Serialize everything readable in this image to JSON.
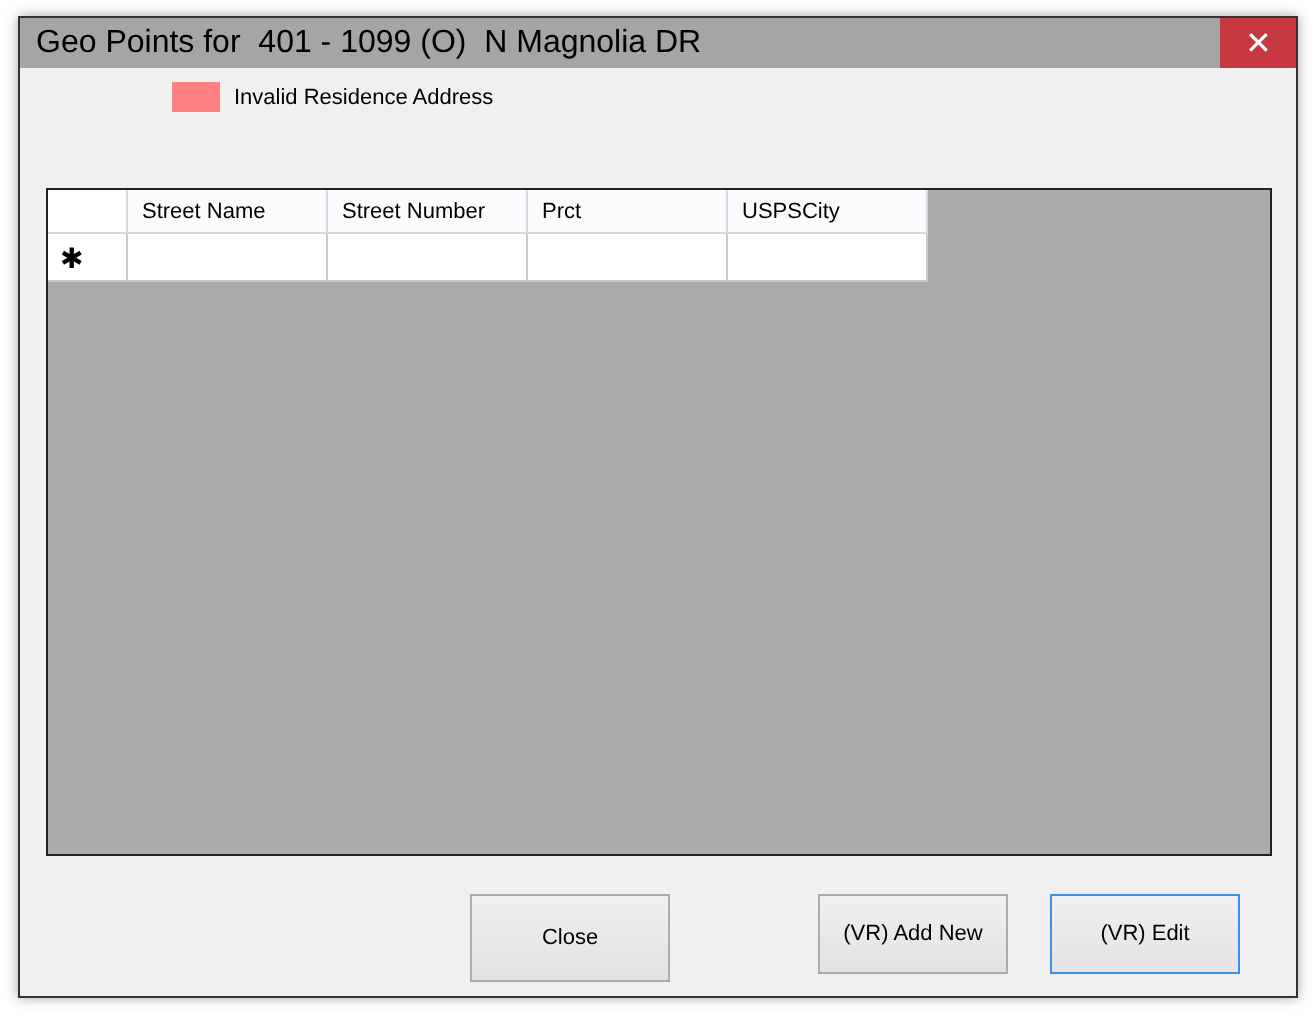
{
  "window": {
    "title": "Geo Points for  401 - 1099 (O)  N Magnolia DR",
    "close_glyph": "✕"
  },
  "legend": {
    "label": "Invalid Residence Address",
    "color": "#ff8080"
  },
  "table": {
    "columns": [
      "Street Name",
      "Street Number",
      "Prct",
      "USPSCity"
    ],
    "new_row_marker": "✱"
  },
  "buttons": [
    {
      "label": "Close",
      "focused": false
    },
    {
      "label": "(VR) Add New",
      "focused": false
    },
    {
      "label": "(VR) Edit",
      "focused": true
    }
  ]
}
